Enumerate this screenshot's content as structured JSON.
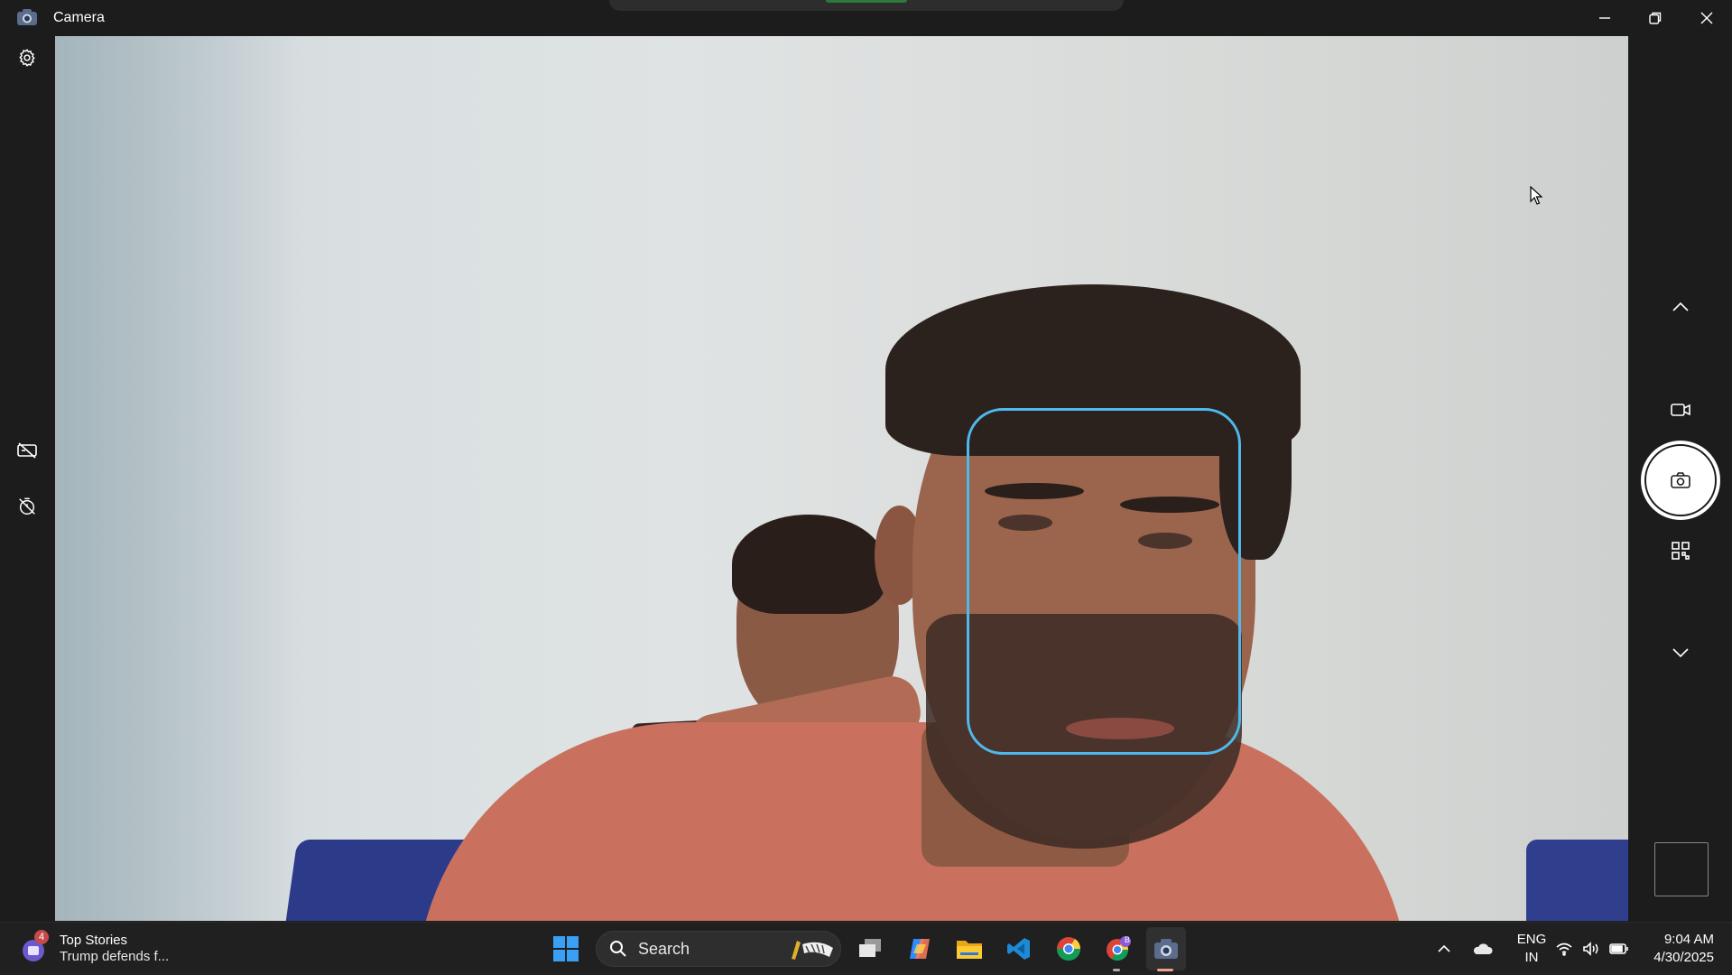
{
  "window": {
    "title": "Camera",
    "app_icon": "camera-app-icon",
    "controls": {
      "minimize": "minimize-icon",
      "maximize": "maximize-icon",
      "close": "close-icon"
    }
  },
  "left_rail": {
    "settings": "gear-icon",
    "hdr": "hdr-off-icon",
    "timer": "timer-off-icon"
  },
  "viewfinder": {
    "face_detection": "face-frame"
  },
  "right_rail": {
    "mode_up": "chevron-up-icon",
    "video_mode": "video-camera-icon",
    "shutter": "camera-icon",
    "qr_mode": "qr-code-icon",
    "mode_down": "chevron-down-icon",
    "thumbnail": "last-capture-thumbnail"
  },
  "taskbar": {
    "news": {
      "badge": "4",
      "title": "Top Stories",
      "subtitle": "Trump defends f..."
    },
    "search": {
      "label": "Search"
    },
    "apps": [
      "start-icon",
      "search-icon",
      "task-view-icon",
      "copilot-icon",
      "file-explorer-icon",
      "vscode-icon",
      "chrome-icon",
      "chrome-profile-icon",
      "camera-icon"
    ],
    "chrome_profile_badge": "B",
    "tray": {
      "lang_top": "ENG",
      "lang_bottom": "IN",
      "time": "9:04 AM",
      "date": "4/30/2025"
    }
  },
  "colors": {
    "face_frame": "#4fb8ec",
    "titlebar": "#1c1c1c",
    "taskbar": "#202020",
    "active_app_indicator": "#f0a38a"
  }
}
